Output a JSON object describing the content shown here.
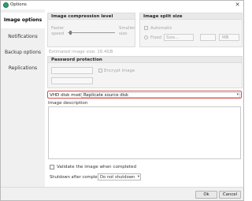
{
  "window": {
    "title": "Options",
    "close_symbol": "✕"
  },
  "sidebar": {
    "items": [
      {
        "label": "Image options",
        "active": true
      },
      {
        "label": "Notifications",
        "active": false
      },
      {
        "label": "Backup options",
        "active": false
      },
      {
        "label": "Replications",
        "active": false
      }
    ]
  },
  "compression": {
    "title": "Image compression level",
    "left_label_1": "Faster",
    "left_label_2": "speed",
    "right_label_1": "Smaller",
    "right_label_2": "size",
    "level": 0.05,
    "estimated_size": "Estimated image size: 16.4GB"
  },
  "split": {
    "title": "Image split size",
    "automatic_label": "Automatic",
    "fixed_label": "Fixed",
    "fixed_value_placeholder": "Size...",
    "unit": "MB"
  },
  "password": {
    "title": "Password protection",
    "encrypt_label": "Encrypt image"
  },
  "vhd": {
    "label": "VHD disk mode",
    "value": "Replicate source disk",
    "arrow": "▾"
  },
  "description": {
    "label": "Image description",
    "value": ""
  },
  "validate": {
    "label": "Validate the image when completed",
    "checked": false
  },
  "shutdown": {
    "label": "Shutdown after completion",
    "value": "Do not shutdown",
    "arrow": "▾"
  },
  "buttons": {
    "ok": "Ok",
    "cancel": "Cancel"
  },
  "colors": {
    "highlight": "#d84a4a",
    "app_icon": "#2f9e6b",
    "sidebar_bg": "#f0f0f0"
  }
}
